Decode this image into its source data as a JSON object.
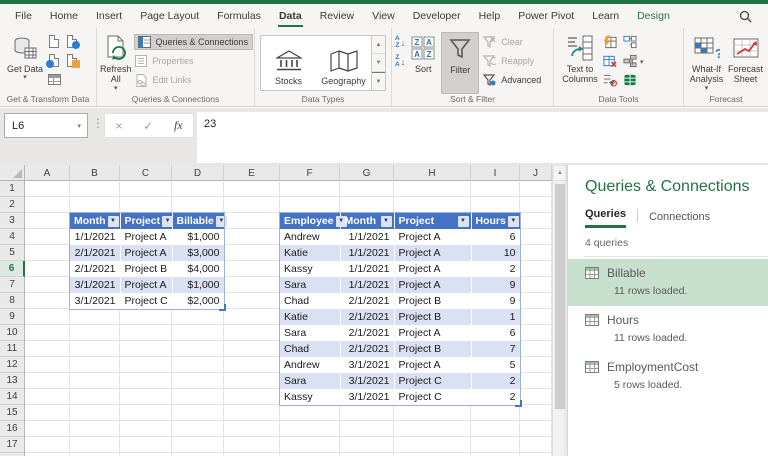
{
  "menu": {
    "tabs": [
      {
        "label": "File"
      },
      {
        "label": "Home"
      },
      {
        "label": "Insert"
      },
      {
        "label": "Page Layout"
      },
      {
        "label": "Formulas"
      },
      {
        "label": "Data",
        "active": true
      },
      {
        "label": "Review"
      },
      {
        "label": "View"
      },
      {
        "label": "Developer"
      },
      {
        "label": "Help"
      },
      {
        "label": "Power Pivot"
      },
      {
        "label": "Learn"
      },
      {
        "label": "Design",
        "contextual": true
      }
    ]
  },
  "ribbon": {
    "groups": [
      "Get & Transform Data",
      "Queries & Connections",
      "Data Types",
      "Sort & Filter",
      "Data Tools",
      "Forecast"
    ],
    "get_data": "Get Data",
    "refresh_all": "Refresh All",
    "queries_connections": "Queries & Connections",
    "properties": "Properties",
    "edit_links": "Edit Links",
    "stocks": "Stocks",
    "geography": "Geography",
    "sort": "Sort",
    "filter": "Filter",
    "clear": "Clear",
    "reapply": "Reapply",
    "advanced": "Advanced",
    "text_to_columns": "Text to Columns",
    "what_if": "What-If Analysis",
    "forecast_sheet": "Forecast Sheet"
  },
  "icons": {
    "caret": "▾",
    "dots": "⋮",
    "cancel": "×",
    "check": "✓",
    "fx": "fx",
    "scroll_up": "▲",
    "gallery_up": "▲",
    "gallery_down": "▼",
    "gallery_more": "▼",
    "sort_a": "A",
    "sort_z": "Z",
    "arrow_down": "↓",
    "question": "?"
  },
  "formula_bar": {
    "name_box": "L6",
    "value": "23"
  },
  "grid": {
    "columns": [
      "A",
      "B",
      "C",
      "D",
      "E",
      "F",
      "G",
      "H",
      "I",
      "J"
    ],
    "rows": [
      {
        "n": "1"
      },
      {
        "n": "2"
      },
      {
        "n": "3"
      },
      {
        "n": "4"
      },
      {
        "n": "5"
      },
      {
        "n": "6",
        "selected": true
      },
      {
        "n": "7"
      },
      {
        "n": "8"
      },
      {
        "n": "9"
      },
      {
        "n": "10"
      },
      {
        "n": "11"
      },
      {
        "n": "12"
      },
      {
        "n": "13"
      },
      {
        "n": "14"
      },
      {
        "n": "15"
      },
      {
        "n": "16"
      },
      {
        "n": "17"
      }
    ]
  },
  "billable_table": {
    "headers": [
      "Month",
      "Project",
      "Billable"
    ],
    "rows": [
      [
        "1/1/2021",
        "Project A",
        "$1,000"
      ],
      [
        "2/1/2021",
        "Project A",
        "$3,000"
      ],
      [
        "2/1/2021",
        "Project B",
        "$4,000"
      ],
      [
        "3/1/2021",
        "Project A",
        "$1,000"
      ],
      [
        "3/1/2021",
        "Project C",
        "$2,000"
      ]
    ]
  },
  "hours_table": {
    "headers": [
      "Employee",
      "Month",
      "Project",
      "Hours"
    ],
    "rows": [
      [
        "Andrew",
        "1/1/2021",
        "Project A",
        "6"
      ],
      [
        "Katie",
        "1/1/2021",
        "Project A",
        "10"
      ],
      [
        "Kassy",
        "1/1/2021",
        "Project A",
        "2"
      ],
      [
        "Sara",
        "1/1/2021",
        "Project A",
        "9"
      ],
      [
        "Chad",
        "2/1/2021",
        "Project B",
        "9"
      ],
      [
        "Katie",
        "2/1/2021",
        "Project B",
        "1"
      ],
      [
        "Sara",
        "2/1/2021",
        "Project A",
        "6"
      ],
      [
        "Chad",
        "2/1/2021",
        "Project B",
        "7"
      ],
      [
        "Andrew",
        "3/1/2021",
        "Project A",
        "5"
      ],
      [
        "Sara",
        "3/1/2021",
        "Project C",
        "2"
      ],
      [
        "Kassy",
        "3/1/2021",
        "Project C",
        "2"
      ]
    ]
  },
  "panel": {
    "title": "Queries & Connections",
    "tab_queries": "Queries",
    "tab_connections": "Connections",
    "count_label": "4 queries",
    "items": [
      {
        "name": "Billable",
        "status": "11 rows loaded.",
        "highlighted": true
      },
      {
        "name": "Hours",
        "status": "11 rows loaded."
      },
      {
        "name": "EmploymentCost",
        "status": "5 rows loaded."
      }
    ]
  },
  "colors": {
    "excel_green": "#217346",
    "table_header_blue": "#4472c4",
    "band_blue": "#d9e1f2",
    "panel_highlight_green": "#c7e0cd"
  }
}
